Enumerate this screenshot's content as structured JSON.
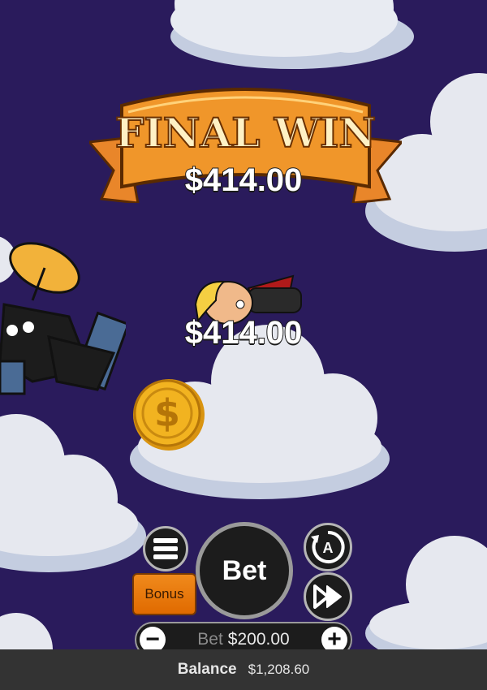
{
  "colors": {
    "background": "#2a1b5c",
    "banner": "#f0962a",
    "coin": "#f2b320",
    "bonus": "#ec7a10"
  },
  "banner": {
    "title": "FINAL WIN",
    "amount": "$414.00"
  },
  "character_win": {
    "amount": "$414.00"
  },
  "icons": {
    "menu": "hamburger-menu-icon",
    "autoplay": "autoplay-icon",
    "fast_forward": "fast-forward-icon",
    "coin": "dollar-coin-icon",
    "satellite": "satellite-icon",
    "character": "flying-hero-icon"
  },
  "controls": {
    "bet_button": "Bet",
    "bonus_button": "Bonus",
    "autoplay_letter": "A",
    "bet_label": "Bet",
    "bet_amount": "$200.00",
    "minus": "−",
    "plus": "+"
  },
  "status": {
    "balance_label": "Balance",
    "balance_value": "$1,208.60"
  }
}
